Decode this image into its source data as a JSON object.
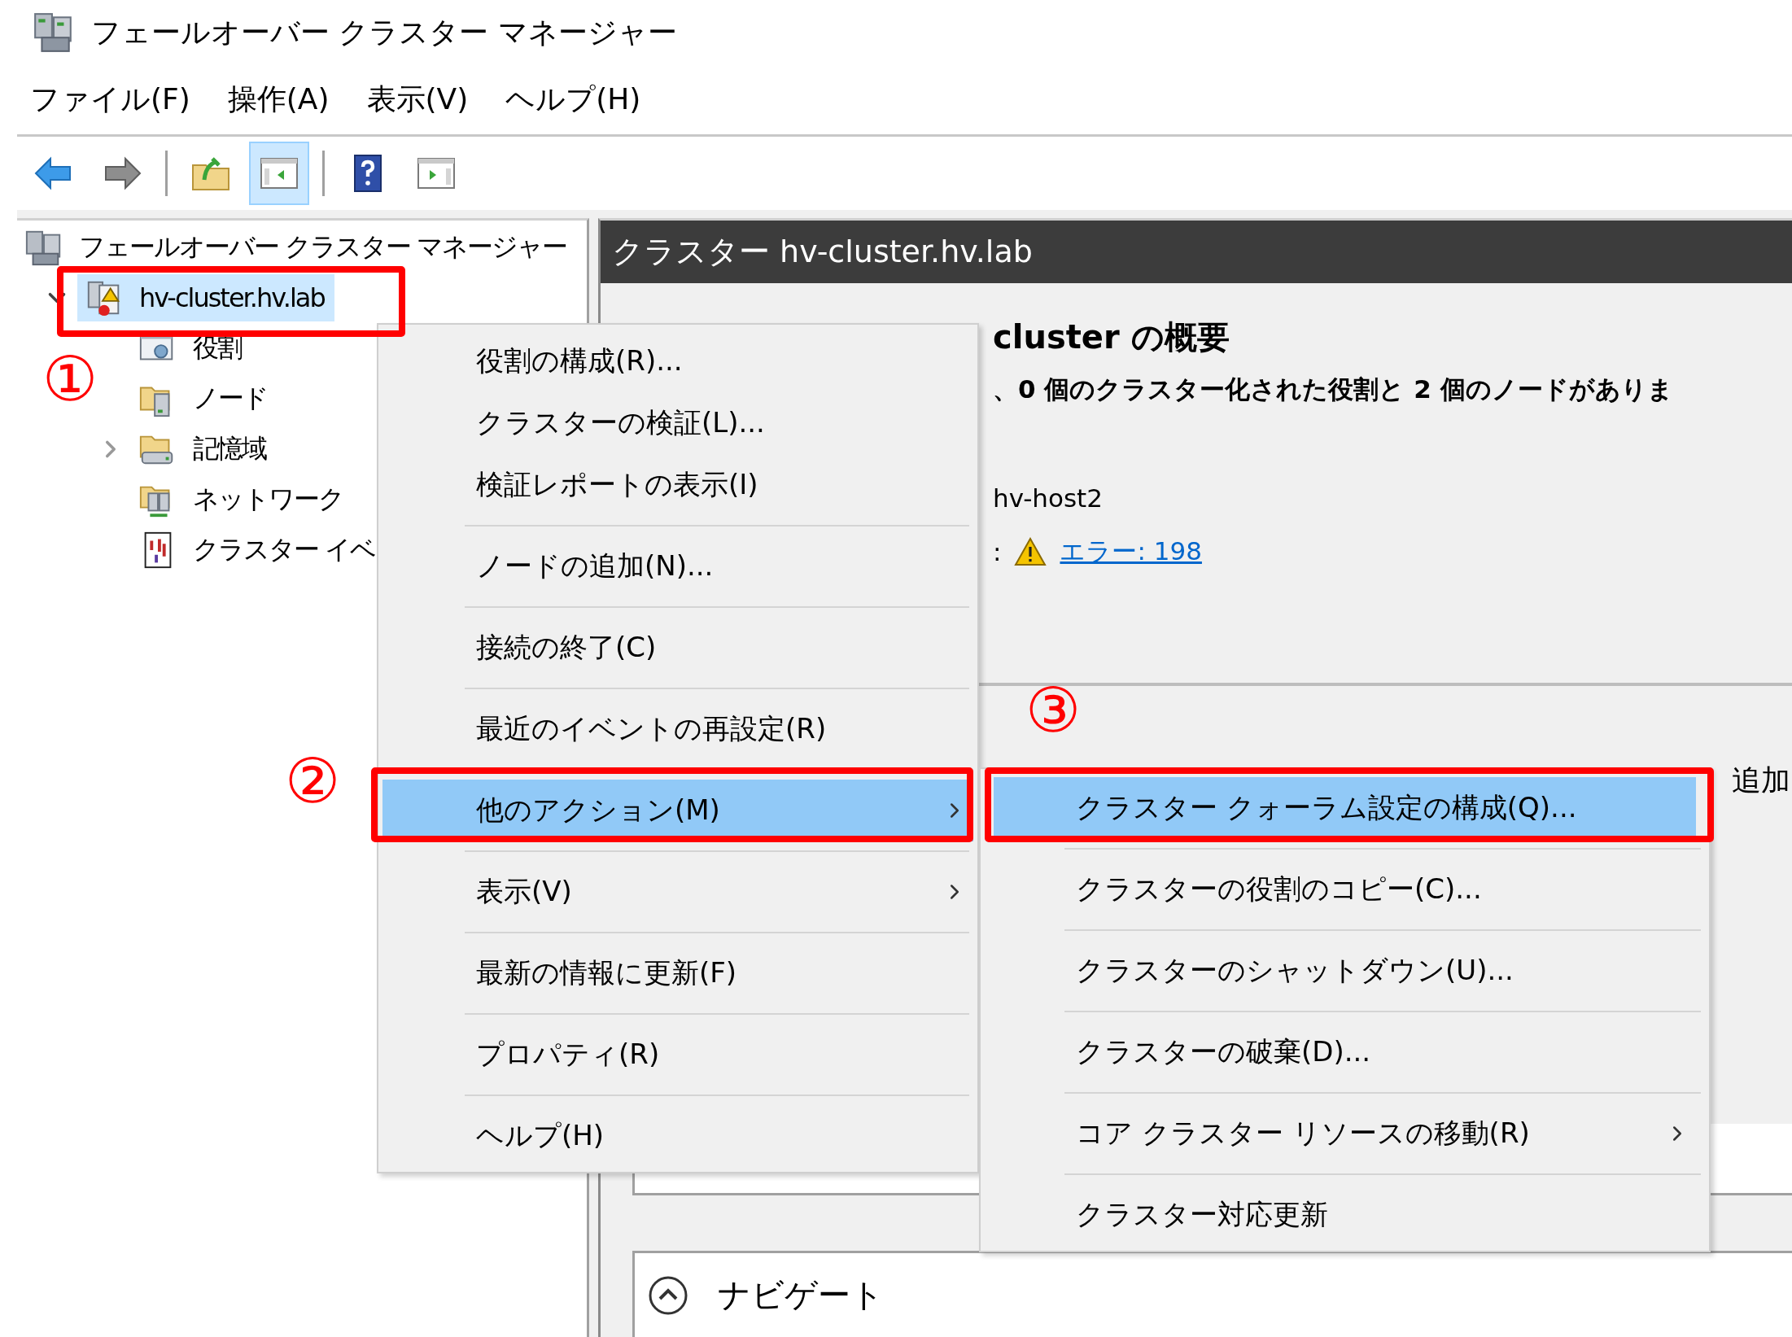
{
  "window": {
    "title": "フェールオーバー クラスター マネージャー"
  },
  "menu_bar": [
    "ファイル(F)",
    "操作(A)",
    "表示(V)",
    "ヘルプ(H)"
  ],
  "toolbar": [
    {
      "kind": "back",
      "selected": false
    },
    {
      "kind": "forward",
      "selected": false
    },
    {
      "kind": "separator"
    },
    {
      "kind": "up",
      "selected": false
    },
    {
      "kind": "hide-pane",
      "selected": true
    },
    {
      "kind": "separator"
    },
    {
      "kind": "help",
      "selected": false
    },
    {
      "kind": "show-pane",
      "selected": false
    }
  ],
  "tree": {
    "label": "フェールオーバー クラスター マネージャー",
    "kind": "manager",
    "children": [
      {
        "label": "hv-cluster.hv.lab",
        "kind": "cluster",
        "expanded": true,
        "selected": true,
        "children": [
          {
            "label": "役割",
            "kind": "roles",
            "selected": false
          },
          {
            "label": "ノード",
            "kind": "nodes",
            "selected": false
          },
          {
            "label": "記憶域",
            "kind": "storage",
            "expanded": false,
            "selected": false
          },
          {
            "label": "ネットワーク",
            "kind": "network",
            "selected": false
          },
          {
            "label": "クラスター イベ",
            "kind": "events",
            "selected": false
          }
        ]
      }
    ]
  },
  "content": {
    "header": "クラスター hv-cluster.hv.lab",
    "summary": {
      "title": "cluster の概要",
      "description": "、0 個のクラスター化された役割と 2 個のノードがありま",
      "host": "hv-host2",
      "events_label": ":",
      "events_link": "エラー: 198"
    },
    "actions_text": "追加",
    "navigate": "ナビゲート"
  },
  "context_menu": {
    "groups": [
      [
        {
          "label": "役割の構成(R)...",
          "selected": false,
          "submenu": false
        },
        {
          "label": "クラスターの検証(L)...",
          "selected": false,
          "submenu": false
        },
        {
          "label": "検証レポートの表示(I)",
          "selected": false,
          "submenu": false
        }
      ],
      [
        {
          "label": "ノードの追加(N)...",
          "selected": false,
          "submenu": false
        }
      ],
      [
        {
          "label": "接続の終了(C)",
          "selected": false,
          "submenu": false
        }
      ],
      [
        {
          "label": "最近のイベントの再設定(R)",
          "selected": false,
          "submenu": false
        }
      ],
      [
        {
          "label": "他のアクション(M)",
          "selected": true,
          "submenu": true
        }
      ],
      [
        {
          "label": "表示(V)",
          "selected": false,
          "submenu": true
        }
      ],
      [
        {
          "label": "最新の情報に更新(F)",
          "selected": false,
          "submenu": false
        }
      ],
      [
        {
          "label": "プロパティ(R)",
          "selected": false,
          "submenu": false
        }
      ],
      [
        {
          "label": "ヘルプ(H)",
          "selected": false,
          "submenu": false
        }
      ]
    ]
  },
  "submenu": {
    "groups": [
      [
        {
          "label": "クラスター クォーラム設定の構成(Q)...",
          "selected": true,
          "submenu": false
        }
      ],
      [
        {
          "label": "クラスターの役割のコピー(C)...",
          "selected": false,
          "submenu": false
        }
      ],
      [
        {
          "label": "クラスターのシャットダウン(U)...",
          "selected": false,
          "submenu": false
        }
      ],
      [
        {
          "label": "クラスターの破棄(D)...",
          "selected": false,
          "submenu": false
        }
      ],
      [
        {
          "label": "コア クラスター リソースの移動(R)",
          "selected": false,
          "submenu": true
        }
      ],
      [
        {
          "label": "クラスター対応更新",
          "selected": false,
          "submenu": false
        }
      ]
    ]
  },
  "callouts": [
    "①",
    "②",
    "③"
  ]
}
